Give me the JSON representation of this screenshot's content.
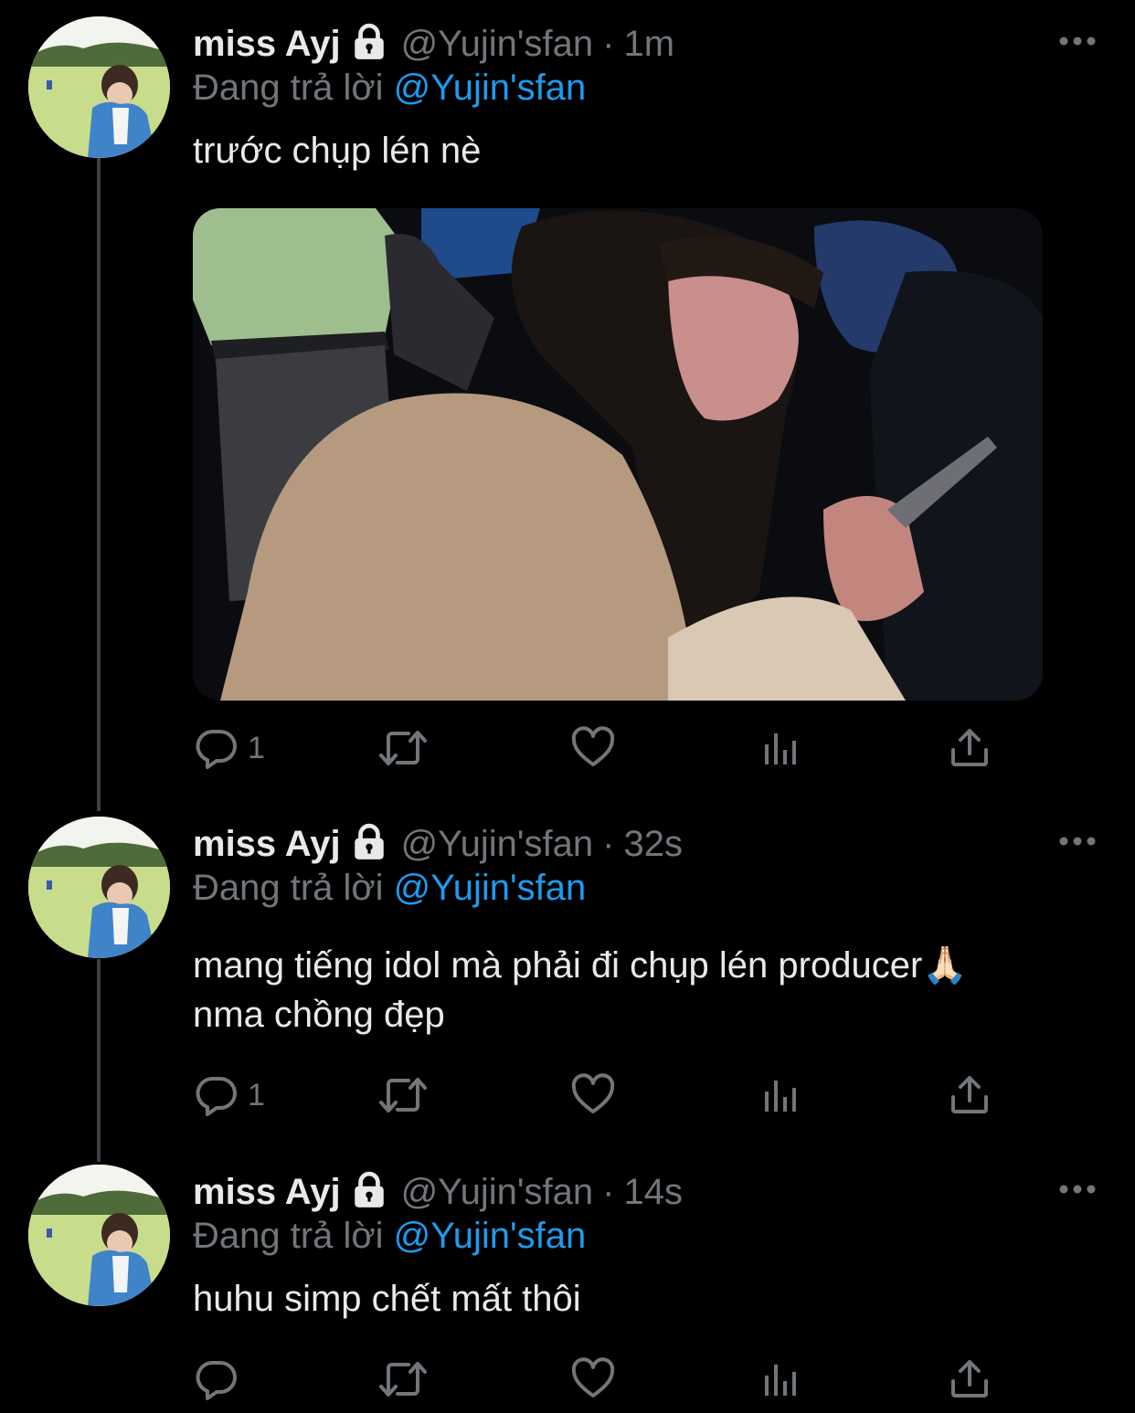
{
  "tweets": [
    {
      "name": "miss Ayj",
      "handle": "@Yujin'sfan",
      "separator": "·",
      "time": "1m",
      "reply_prefix": "Đang trả lời",
      "reply_mention": "@Yujin'sfan",
      "text": "trước chụp lén nè",
      "has_media": true,
      "reply_count": "1"
    },
    {
      "name": "miss Ayj",
      "handle": "@Yujin'sfan",
      "separator": "·",
      "time": "32s",
      "reply_prefix": "Đang trả lời",
      "reply_mention": "@Yujin'sfan",
      "text_line1": "mang tiếng idol mà phải đi chụp lén producer🙏🏻",
      "text_line2": "nma chồng đẹp",
      "has_media": false,
      "reply_count": "1"
    },
    {
      "name": "miss Ayj",
      "handle": "@Yujin'sfan",
      "separator": "·",
      "time": "14s",
      "reply_prefix": "Đang trả lời",
      "reply_mention": "@Yujin'sfan",
      "text": "huhu simp chết mất thôi",
      "has_media": false,
      "reply_count": ""
    }
  ],
  "icons": {
    "lock": "lock-icon",
    "more": "more-icon",
    "reply": "reply-icon",
    "retweet": "retweet-icon",
    "like": "heart-icon",
    "analytics": "analytics-icon",
    "share": "share-icon"
  },
  "colors": {
    "background": "#000000",
    "text": "#e7e9ea",
    "secondary": "#71767b",
    "mention": "#1d9bf0",
    "thread_line": "#3e4144"
  }
}
